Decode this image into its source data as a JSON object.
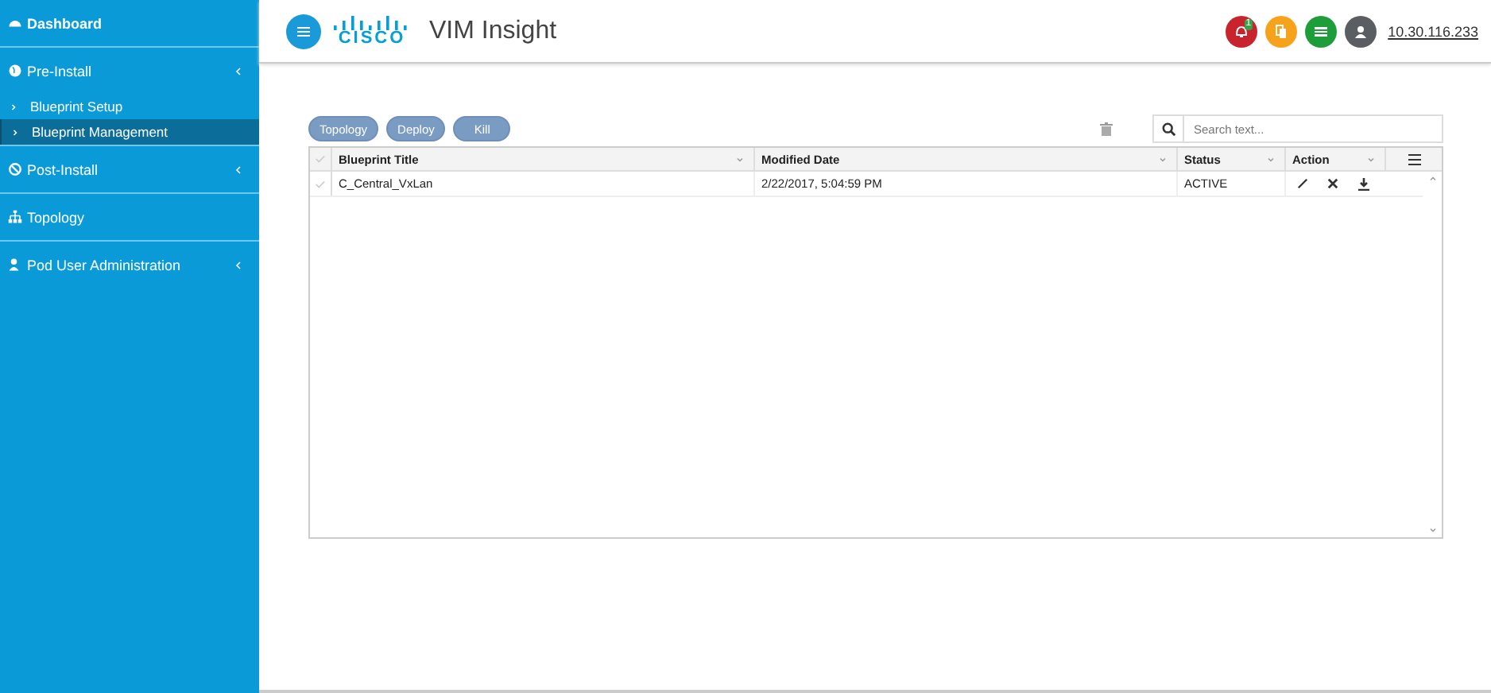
{
  "sidebar": {
    "items": [
      {
        "label": "Dashboard",
        "kind": "link"
      },
      {
        "label": "Pre-Install",
        "kind": "group",
        "children": [
          {
            "label": "Blueprint Setup",
            "selected": false
          },
          {
            "label": "Blueprint Management",
            "selected": true
          }
        ]
      },
      {
        "label": "Post-Install",
        "kind": "group"
      },
      {
        "label": "Topology",
        "kind": "link"
      },
      {
        "label": "Pod User Administration",
        "kind": "group"
      }
    ]
  },
  "header": {
    "title": "VIM Insight",
    "logo_text": "CISCO",
    "notification_count": "1",
    "address": "10.30.116.233"
  },
  "toolbar": {
    "buttons": [
      "Topology",
      "Deploy",
      "Kill"
    ],
    "search": {
      "placeholder": "Search text..."
    }
  },
  "table": {
    "columns": [
      "Blueprint Title",
      "Modified Date",
      "Status",
      "Action"
    ],
    "rows": [
      {
        "cells": [
          "C_Central_VxLan",
          "2/22/2017, 5:04:59 PM",
          "ACTIVE"
        ],
        "checked": false
      }
    ]
  }
}
